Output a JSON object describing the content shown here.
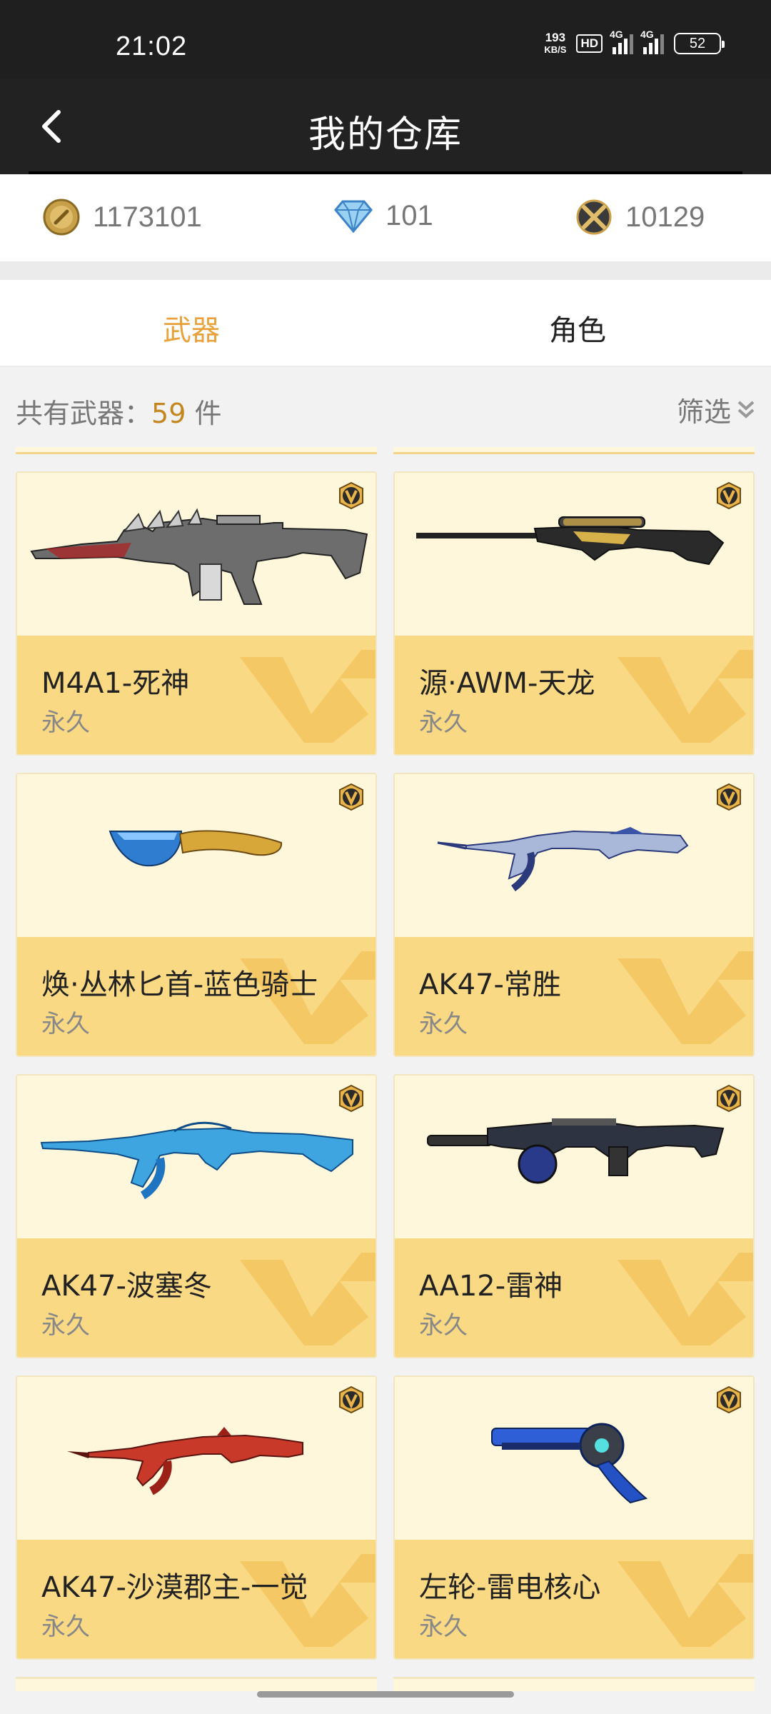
{
  "status_bar": {
    "time": "21:02",
    "net_speed_value": "193",
    "net_speed_unit": "KB/S",
    "hd": "HD",
    "signal1": "4G",
    "signal2": "4G",
    "battery": "52"
  },
  "header": {
    "title": "我的仓库"
  },
  "currencies": {
    "gold": "1173101",
    "diamond": "101",
    "points": "10129"
  },
  "tabs": [
    {
      "label": "武器",
      "active": true
    },
    {
      "label": "角色",
      "active": false
    }
  ],
  "summary": {
    "prefix": "共有武器：",
    "count": "59",
    "suffix": " 件",
    "filter_label": "筛选"
  },
  "items": [
    {
      "name": "M4A1-死神",
      "duration": "永久"
    },
    {
      "name": "源·AWM-天龙",
      "duration": "永久"
    },
    {
      "name": "焕·丛林匕首-蓝色骑士",
      "duration": "永久"
    },
    {
      "name": "AK47-常胜",
      "duration": "永久"
    },
    {
      "name": "AK47-波塞冬",
      "duration": "永久"
    },
    {
      "name": "AA12-雷神",
      "duration": "永久"
    },
    {
      "name": "AK47-沙漠郡主-一觉",
      "duration": "永久"
    },
    {
      "name": "左轮-雷电核心",
      "duration": "永久"
    }
  ],
  "colors": {
    "accent": "#e9a23b",
    "card_bg": "#fff7dc",
    "card_bottom": "#f9d984",
    "header_bg": "#222222"
  }
}
